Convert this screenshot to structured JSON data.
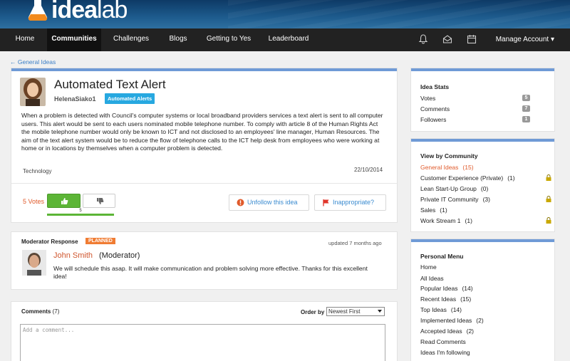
{
  "brand": {
    "name_a": "idea",
    "name_b": "lab"
  },
  "nav": {
    "items": [
      "Home",
      "Communities",
      "Challenges",
      "Blogs",
      "Getting to Yes",
      "Leaderboard"
    ],
    "active": "Communities",
    "manage": "Manage Account ▾"
  },
  "breadcrumb": "← General Ideas",
  "idea": {
    "title": "Automated Text Alert",
    "author": "HelenaSiako1",
    "tag": "Automated Alerts",
    "body": "When a problem is detected with Council's computer systems or local broadband providers services a text alert is sent to all computer users. This alert would be sent to each users nominated mobile telephone number. To comply with article 8 of the Human Rights Act the mobile telephone number would only be known to ICT and not disclosed to an employees' line manager, Human Resources. The aim of the text alert system would be to reduce the flow of telephone calls to the ICT help desk from employees who were working at home or in locations by themselves when a computer problem is detected.",
    "category": "Technology",
    "date": "22/10/2014",
    "votes_label": "5 Votes",
    "vote_count": "5",
    "unfollow": "Unfollow this idea",
    "inappropriate": "Inappropriate?"
  },
  "moderator": {
    "heading": "Moderator Response",
    "status": "PLANNED",
    "updated": "updated 7 months ago",
    "name": "John Smith",
    "role": "(Moderator)",
    "text": "We will schedule this asap. It will make communication and problem solving more effective. Thanks for this excellent idea!"
  },
  "comments": {
    "label": "Comments",
    "count": "(7)",
    "order_label": "Order by",
    "order_value": "Newest First",
    "placeholder": "Add a comment..."
  },
  "stats": {
    "heading": "Idea Stats",
    "rows": [
      {
        "label": "Votes",
        "value": "5"
      },
      {
        "label": "Comments",
        "value": "7"
      },
      {
        "label": "Followers",
        "value": "1"
      }
    ]
  },
  "communities": {
    "heading": "View by Community",
    "items": [
      {
        "label": "General Ideas",
        "count": "(15)",
        "locked": false
      },
      {
        "label": "Customer Experience (Private)",
        "count": "(1)",
        "locked": true
      },
      {
        "label": "Lean Start-Up Group",
        "count": "(0)",
        "locked": false
      },
      {
        "label": "Private IT Community",
        "count": "(3)",
        "locked": true
      },
      {
        "label": "Sales",
        "count": "(1)",
        "locked": false
      },
      {
        "label": "Work Stream 1",
        "count": "(1)",
        "locked": true
      }
    ]
  },
  "personal": {
    "heading": "Personal Menu",
    "items": [
      {
        "label": "Home",
        "count": ""
      },
      {
        "label": "All Ideas",
        "count": ""
      },
      {
        "label": "Popular Ideas",
        "count": "(14)"
      },
      {
        "label": "Recent Ideas",
        "count": "(15)"
      },
      {
        "label": "Top Ideas",
        "count": "(14)"
      },
      {
        "label": "Implemented Ideas",
        "count": "(2)"
      },
      {
        "label": "Accepted Ideas",
        "count": "(2)"
      },
      {
        "label": "Read Comments",
        "count": ""
      },
      {
        "label": "Ideas I'm following",
        "count": ""
      }
    ]
  },
  "colors": {
    "accent": "#e05a2b",
    "link": "#3a7ec6",
    "panel_top": "#6f9ad6",
    "vote_green": "#5cb536",
    "tag_blue": "#27a8e0",
    "planned_orange": "#f07c33"
  }
}
